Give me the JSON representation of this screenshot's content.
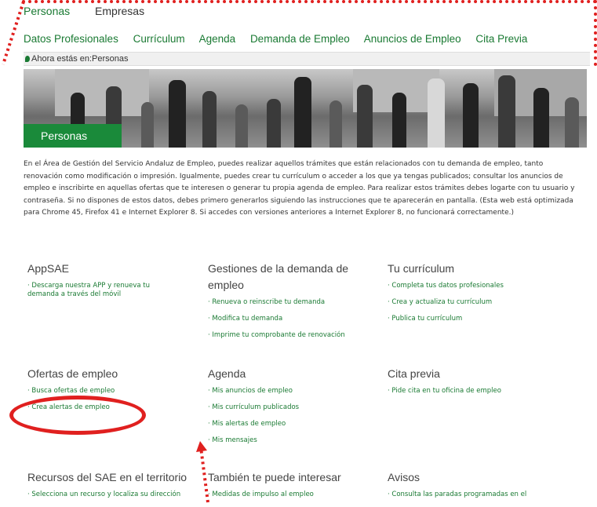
{
  "top_tabs": [
    "Personas",
    "Empresas"
  ],
  "sub_nav": [
    "Datos Profesionales",
    "Currículum",
    "Agenda",
    "Demanda de Empleo",
    "Anuncios de Empleo",
    "Cita Previa"
  ],
  "breadcrumb": "Ahora estás en:Personas",
  "hero_label": "Personas",
  "intro_lines": [
    "En el Área de Gestión del Servicio Andaluz de Empleo, puedes realizar aquellos trámites que están relacionados con tu demanda de empleo, tanto",
    "renovación como modificación o impresión. Igualmente, puedes crear tu currículum o acceder a los que ya tengas publicados; consultar los anuncios de",
    "empleo e inscribirte en aquellas ofertas que te interesen o generar tu propia agenda de empleo. Para realizar estos trámites debes logarte con tu usuario y",
    "contraseña. Si no dispones de estos datos, debes primero generarlos siguiendo las instrucciones que te aparecerán en pantalla. (Esta web está optimizada",
    "para Chrome 45, Firefox 41 e Internet Explorer 8. Si accedes con versiones anteriores a Internet Explorer 8, no funcionará correctamente.)"
  ],
  "sections": {
    "appsae": {
      "title": "AppSAE",
      "items": [
        "Descarga nuestra APP y renueva tu demanda a través del móvil"
      ]
    },
    "gestiones": {
      "title": "Gestiones de la demanda de empleo",
      "items": [
        "Renueva o reinscribe tu demanda",
        "Modifica tu demanda",
        "Imprime tu comprobante de renovación"
      ]
    },
    "curriculum": {
      "title": "Tu currículum",
      "items": [
        "Completa tus datos profesionales",
        "Crea y actualiza tu currículum",
        "Publica tu currículum"
      ]
    },
    "ofertas": {
      "title": "Ofertas de empleo",
      "items": [
        "Busca ofertas de empleo",
        "Crea alertas de empleo"
      ]
    },
    "agenda": {
      "title": "Agenda",
      "items": [
        "Mis anuncios de empleo",
        "Mis currículum publicados",
        "Mis alertas de empleo",
        "Mis mensajes"
      ]
    },
    "cita": {
      "title": "Cita previa",
      "items": [
        "Pide cita en tu oficina de empleo"
      ]
    },
    "recursos": {
      "title": "Recursos del SAE en el territorio",
      "items": [
        "Selecciona un recurso y localiza su dirección"
      ]
    },
    "interesar": {
      "title": "También te puede interesar",
      "items": [
        "Medidas de impulso al empleo"
      ]
    },
    "avisos": {
      "title": "Avisos",
      "items": [
        "Consulta las paradas programadas en el"
      ]
    }
  },
  "colors": {
    "accent": "#1a7a33",
    "highlight": "#e0201f"
  },
  "icons": {
    "breadcrumb": "location-pin-icon"
  }
}
